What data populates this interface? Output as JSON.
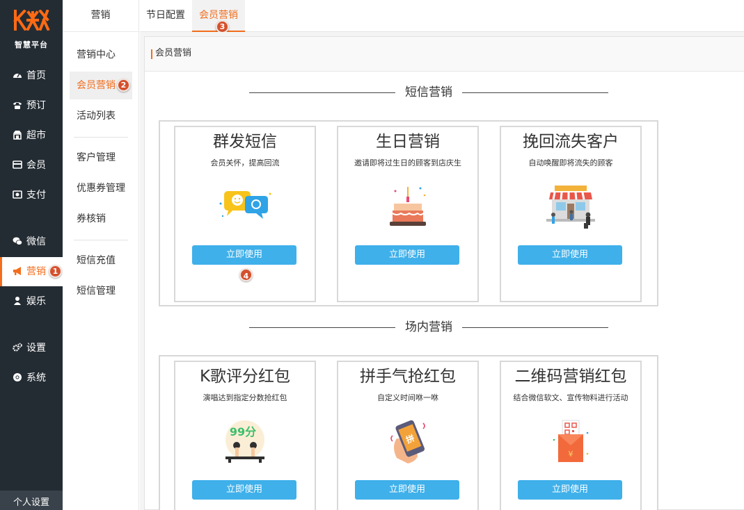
{
  "brand": {
    "logo_text": "KЖ",
    "subtitle": "智慧平台"
  },
  "sidebar": {
    "items": [
      {
        "label": "首页",
        "icon": "dashboard-icon"
      },
      {
        "label": "预订",
        "icon": "phone-icon"
      },
      {
        "label": "超市",
        "icon": "shop-icon"
      },
      {
        "label": "会员",
        "icon": "card-icon"
      },
      {
        "label": "支付",
        "icon": "payment-icon"
      },
      {
        "label": "微信",
        "icon": "wechat-icon"
      },
      {
        "label": "营销",
        "icon": "megaphone-icon",
        "active": true
      },
      {
        "label": "娱乐",
        "icon": "entertainment-icon"
      },
      {
        "label": "设置",
        "icon": "gear-icon"
      },
      {
        "label": "系统",
        "icon": "chrome-icon"
      }
    ],
    "footer": "个人设置"
  },
  "submenu": {
    "title": "营销",
    "items": [
      "营销中心",
      "会员营销",
      "活动列表",
      "客户管理",
      "优惠券管理",
      "券核销",
      "短信充值",
      "短信管理"
    ]
  },
  "tabs": [
    "节日配置",
    "会员营销"
  ],
  "breadcrumb": "会员营销",
  "badges": [
    "1",
    "2",
    "3",
    "4"
  ],
  "sections": [
    {
      "title": "短信营销",
      "cards": [
        {
          "title": "群发短信",
          "desc": "会员关怀，提高回流",
          "button": "立即使用",
          "art": "chat-bubbles-illustration"
        },
        {
          "title": "生日营销",
          "desc": "邀请即将过生日的顾客到店庆生",
          "button": "立即使用",
          "art": "birthday-cake-illustration"
        },
        {
          "title": "挽回流失客户",
          "desc": "自动唤醒即将流失的顾客",
          "button": "立即使用",
          "art": "storefront-illustration"
        }
      ]
    },
    {
      "title": "场内营销",
      "cards": [
        {
          "title": "K歌评分红包",
          "desc": "演唱达到指定分数抢红包",
          "button": "立即使用",
          "art": "karaoke-score-illustration",
          "score": "99分"
        },
        {
          "title": "拼手气抢红包",
          "desc": "自定义时间咻一咻",
          "button": "立即使用",
          "art": "phone-shake-illustration"
        },
        {
          "title": "二维码营销红包",
          "desc": "结合微信软文、宣传物料进行活动",
          "button": "立即使用",
          "art": "qr-red-envelope-illustration",
          "yen": "¥"
        }
      ]
    }
  ],
  "colors": {
    "accent": "#f26d1c",
    "sidebar_bg": "#242c33",
    "button": "#3fb0ea",
    "badge": "#d4502d"
  }
}
